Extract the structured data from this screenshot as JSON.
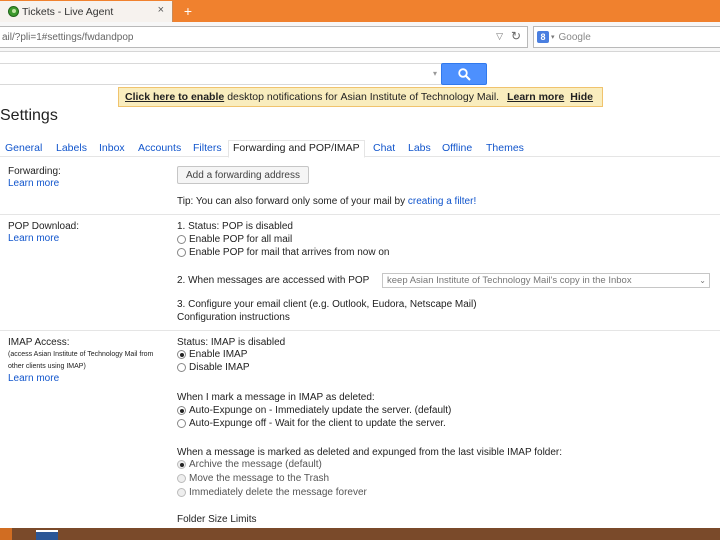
{
  "browser": {
    "tab_title": "Tickets - Live Agent",
    "tab_close": "×",
    "new_tab": "+",
    "url": "ail/?pli=1#settings/fwdandpop",
    "url_dropdown": "▽",
    "reload": "↻",
    "search_badge": "8",
    "search_caret": "▾",
    "search_engine": "Google",
    "icons": [
      "live-agent-favicon",
      "close-icon",
      "plus-icon",
      "dropdown-icon",
      "reload-icon",
      "google-search-icon"
    ]
  },
  "gmail": {
    "search_caret": "▾",
    "search_button_icon": "magnifier-icon",
    "accent": "#4d90fe"
  },
  "notice": {
    "enable_link": "Click here to enable",
    "middle": "desktop notifications for",
    "org": "Asian Institute of Technology Mail.",
    "learn_more": "Learn more",
    "hide": "Hide",
    "bg": "#f9edbe"
  },
  "settings": {
    "title": "Settings",
    "tabs": [
      "General",
      "Labels",
      "Inbox",
      "Accounts",
      "Filters",
      "Forwarding and POP/IMAP",
      "Chat",
      "Labs",
      "Offline",
      "Themes"
    ],
    "active_tab": "Forwarding and POP/IMAP"
  },
  "forwarding": {
    "label": "Forwarding:",
    "learn_more": "Learn more",
    "button": "Add a forwarding address",
    "tip_prefix": "Tip: You can also forward only some of your mail by",
    "tip_link": "creating a filter!"
  },
  "pop": {
    "label": "POP Download:",
    "learn_more": "Learn more",
    "status": "1. Status: POP is disabled",
    "options": [
      {
        "label": "Enable POP for all mail",
        "checked": false
      },
      {
        "label": "Enable POP for mail that arrives from now on",
        "checked": false
      }
    ],
    "step2": "2. When messages are accessed with POP",
    "step2_select": "keep Asian Institute of Technology Mail's copy in the Inbox",
    "step2_caret": "⌄",
    "step3": "3. Configure your email client (e.g. Outlook, Eudora, Netscape Mail)",
    "config_link": "Configuration instructions"
  },
  "imap": {
    "label": "IMAP Access:",
    "note_line1": "(access Asian Institute of Technology Mail from",
    "note_line2": "other clients using IMAP)",
    "learn_more": "Learn more",
    "status": "Status: IMAP is disabled",
    "options": [
      {
        "label": "Enable IMAP",
        "checked": true
      },
      {
        "label": "Disable IMAP",
        "checked": false
      }
    ],
    "deleted_heading": "When I mark a message in IMAP as deleted:",
    "deleted_options": [
      {
        "label": "Auto-Expunge on - Immediately update the server. (default)",
        "checked": true
      },
      {
        "label": "Auto-Expunge off - Wait for the client to update the server.",
        "checked": false
      }
    ],
    "expunged_heading": "When a message is marked as deleted and expunged from the last visible IMAP folder:",
    "expunged_options": [
      {
        "label": "Archive the message (default)",
        "checked": true
      },
      {
        "label": "Move the message to the Trash",
        "checked": false
      },
      {
        "label": "Immediately delete the message forever",
        "checked": false
      }
    ],
    "folder_size": "Folder Size Limits"
  }
}
